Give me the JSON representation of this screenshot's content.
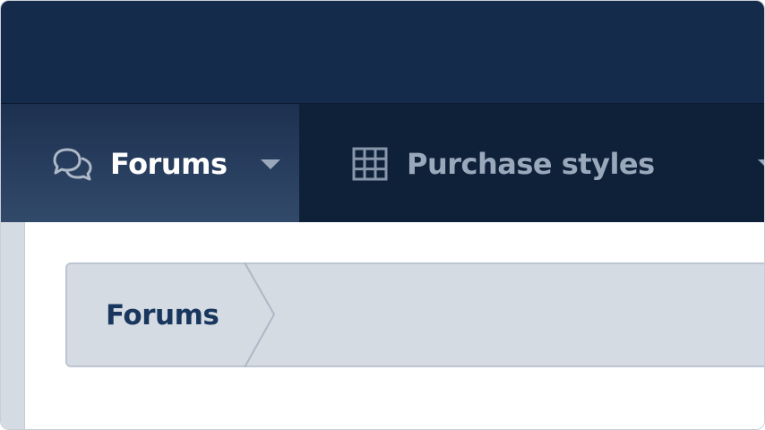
{
  "colors": {
    "header_bg": "#142b4c",
    "nav_bg": "#0f2139",
    "active_tab": "#324a6a",
    "nav_text_muted": "#9aa8bb",
    "breadcrumb_bg": "#d5dbe2",
    "breadcrumb_text": "#18365e"
  },
  "nav": {
    "tabs": [
      {
        "label": "Forums",
        "icon": "chat-bubbles-icon",
        "active": true,
        "has_dropdown": true
      },
      {
        "label": "Purchase styles",
        "icon": "grid-icon",
        "active": false,
        "has_dropdown": true
      }
    ]
  },
  "breadcrumb": {
    "items": [
      {
        "label": "Forums"
      }
    ]
  }
}
